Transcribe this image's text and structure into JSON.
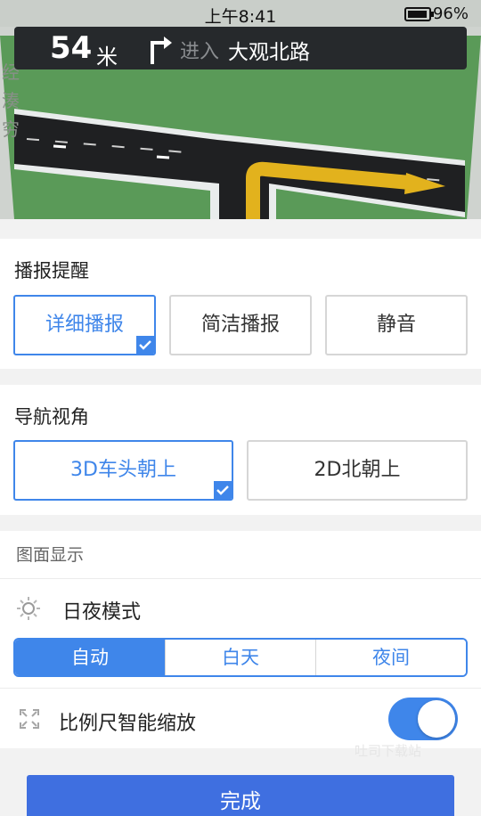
{
  "status_bar": {
    "time": "上午8:41",
    "battery": "96%",
    "battery_level": 0.96
  },
  "map": {
    "road_fragment_1": "经",
    "road_fragment_2": "湊",
    "road_fragment_3": "穷"
  },
  "guidance": {
    "distance": "54",
    "distance_unit": "米",
    "enter_label": "进入",
    "road_name": "大观北路",
    "turn_icon": "turn-right-arrow"
  },
  "broadcast": {
    "title": "播报提醒",
    "options": [
      {
        "label": "详细播报",
        "selected": true
      },
      {
        "label": "简洁播报",
        "selected": false
      },
      {
        "label": "静音",
        "selected": false
      }
    ]
  },
  "view": {
    "title": "导航视角",
    "options": [
      {
        "label": "3D车头朝上",
        "selected": true
      },
      {
        "label": "2D北朝上",
        "selected": false
      }
    ]
  },
  "display": {
    "title": "图面显示",
    "day_night": {
      "label": "日夜模式",
      "icon": "sun-icon",
      "options": [
        {
          "label": "自动",
          "active": true
        },
        {
          "label": "白天",
          "active": false
        },
        {
          "label": "夜间",
          "active": false
        }
      ]
    },
    "scale_zoom": {
      "label": "比例尺智能缩放",
      "icon": "expand-icon",
      "enabled": true
    }
  },
  "watermark": "吐司下载站",
  "done_button": "完成",
  "colors": {
    "accent": "#3f86ea",
    "done": "#3f6fe0",
    "road": "#1f2022",
    "grass": "#5a9a58",
    "turn_arrow": "#e2b21d"
  }
}
